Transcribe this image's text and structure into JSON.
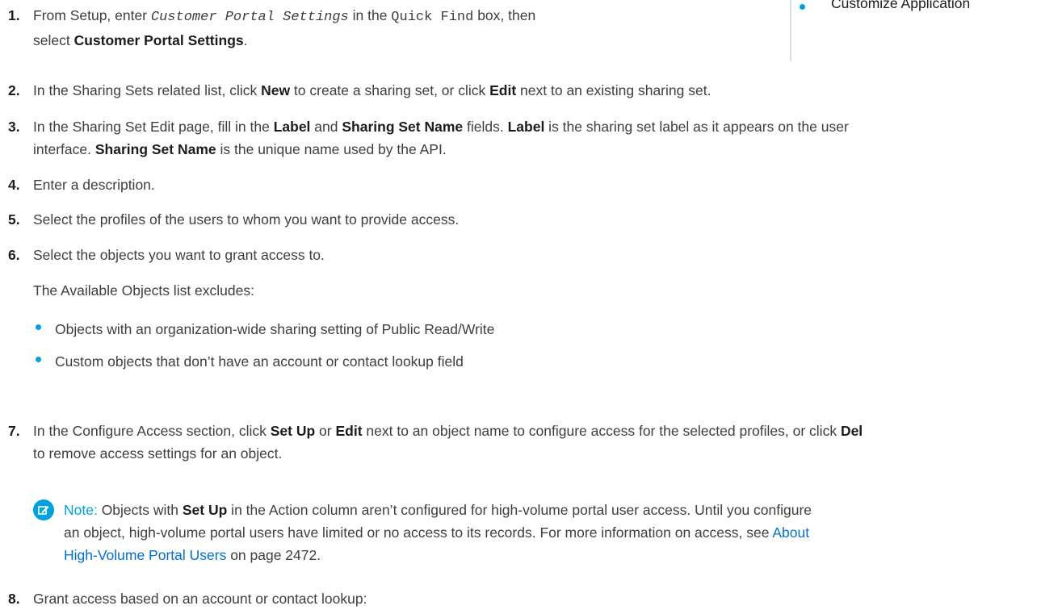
{
  "sidebar": {
    "bullet_text": "Customize Application"
  },
  "steps": [
    {
      "num": "1.",
      "a": "From Setup, enter ",
      "code": "Customer Portal Settings",
      "b": " in the ",
      "code2": "Quick Find",
      "c": " box, then",
      "line2a": "select ",
      "bold": "Customer Portal Settings",
      "line2b": "."
    },
    {
      "num": "2.",
      "a": "In the Sharing Sets related list, click ",
      "b1": "New",
      "b": " to create a sharing set, or click ",
      "b2": "Edit",
      "c": " next to an existing sharing set."
    },
    {
      "num": "3.",
      "a": "In the Sharing Set Edit page, fill in the ",
      "b1": "Label",
      "b": " and ",
      "b2": "Sharing Set Name",
      "c": " fields. ",
      "b3": "Label",
      "d": " is the sharing set label as it appears on the user",
      "line2": "interface. ",
      "b4": "Sharing Set Name",
      "e": " is the unique name used by the API."
    },
    {
      "num": "4.",
      "text": "Enter a description."
    },
    {
      "num": "5.",
      "text": "Select the profiles of the users to whom you want to provide access."
    },
    {
      "num": "6.",
      "text": "Select the objects you want to grant access to.",
      "sub": "The Available Objects list excludes:",
      "bullets": [
        "Objects with an organization-wide sharing setting of Public Read/Write",
        "Custom objects that don’t have an account or contact lookup field"
      ]
    },
    {
      "num": "7.",
      "a": "In the Configure Access section, click ",
      "b1": "Set Up",
      "b": " or ",
      "b2": "Edit",
      "c": " next to an object name to configure access for the selected profiles, or click ",
      "b3": "Del",
      "line2": "to remove access settings for an object."
    },
    {
      "num": "8.",
      "text": "Grant access based on an account or contact lookup:"
    }
  ],
  "note": {
    "label": "Note:",
    "a": " Objects with ",
    "bold": "Set Up",
    "b": " in the Action column aren’t configured for high-volume portal user access. Until you configure",
    "line2": "an object, high-volume portal users have limited or no access to its records. For more information on access, see ",
    "link1": "About",
    "link2": "High-Volume Portal Users",
    "tail": " on page 2472."
  }
}
